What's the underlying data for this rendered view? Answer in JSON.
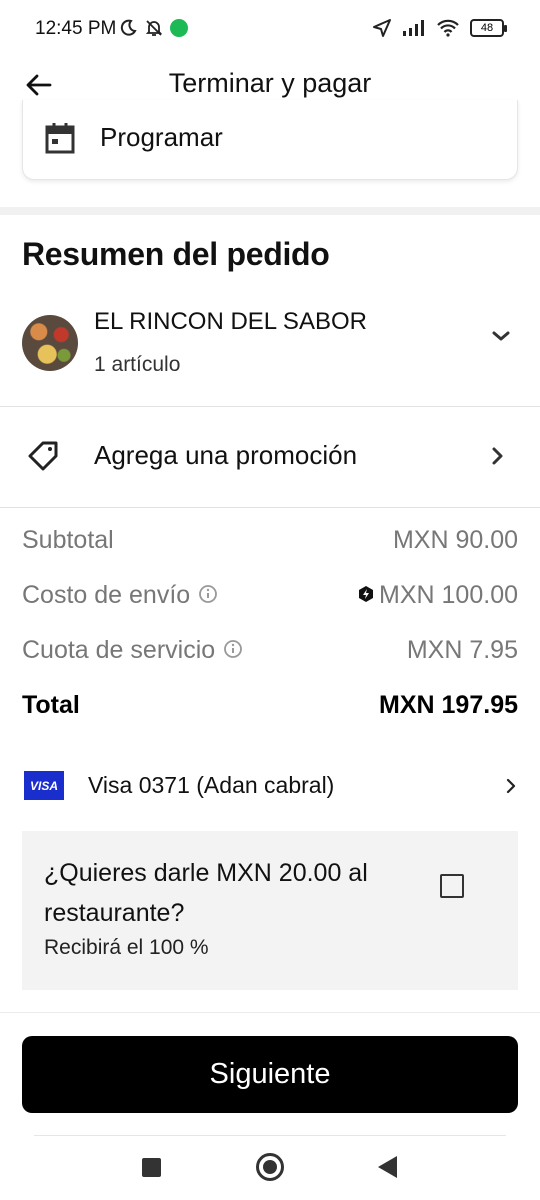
{
  "status_bar": {
    "time": "12:45 PM",
    "battery": "48",
    "icons": [
      "moon-icon",
      "bell-off-icon",
      "app-icon",
      "location-arrow-icon",
      "signal-icon",
      "wifi-icon",
      "battery-icon"
    ]
  },
  "header": {
    "title": "Terminar y pagar",
    "back_icon": "arrow-left-icon"
  },
  "schedule": {
    "label": "Programar",
    "icon": "calendar-icon"
  },
  "order_summary": {
    "title": "Resumen del pedido",
    "restaurant": {
      "name": "EL RINCON DEL SABOR",
      "items": "1 artículo"
    }
  },
  "promotion": {
    "label": "Agrega una promoción",
    "icon": "tag-icon"
  },
  "prices": {
    "subtotal_label": "Subtotal",
    "subtotal_value": "MXN 90.00",
    "delivery_label": "Costo de envío",
    "delivery_value": "MXN 100.00",
    "service_label": "Cuota de servicio",
    "service_value": "MXN 7.95",
    "total_label": "Total",
    "total_value": "MXN 197.95"
  },
  "payment": {
    "brand": "VISA",
    "label": "Visa 0371 (Adan cabral)"
  },
  "tip": {
    "question": "¿Quieres darle MXN 20.00 al restaurante?",
    "subtitle": "Recibirá el 100 %",
    "checked": false
  },
  "next_button": {
    "label": "Siguiente"
  },
  "colors": {
    "primary_button": "#000000",
    "visa_blue": "#1a2dcd",
    "muted_text": "#777777",
    "tip_background": "#f3f3f3"
  }
}
